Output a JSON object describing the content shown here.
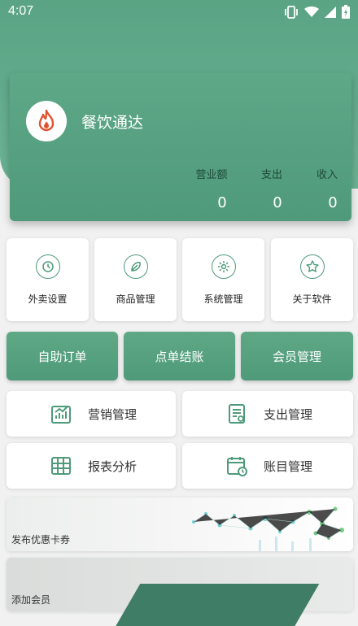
{
  "status": {
    "time": "4:07"
  },
  "app": {
    "name": "餐饮通达"
  },
  "stats": [
    {
      "label": "营业额",
      "value": "0"
    },
    {
      "label": "支出",
      "value": "0"
    },
    {
      "label": "收入",
      "value": "0"
    }
  ],
  "quick": [
    {
      "label": "外卖设置",
      "icon": "clock-icon"
    },
    {
      "label": "商品管理",
      "icon": "leaf-icon"
    },
    {
      "label": "系统管理",
      "icon": "gear-icon"
    },
    {
      "label": "关于软件",
      "icon": "star-icon"
    }
  ],
  "buttons": [
    {
      "label": "自助订单"
    },
    {
      "label": "点单结账"
    },
    {
      "label": "会员管理"
    }
  ],
  "menu": [
    {
      "label": "营销管理",
      "icon": "chart-icon"
    },
    {
      "label": "支出管理",
      "icon": "document-icon"
    },
    {
      "label": "报表分析",
      "icon": "table-icon"
    },
    {
      "label": "账目管理",
      "icon": "calendar-icon"
    }
  ],
  "banners": [
    {
      "label": "发布优惠卡券"
    },
    {
      "label": "添加会员"
    }
  ],
  "colors": {
    "primary": "#5aa384",
    "dark": "#1f4a3a",
    "icon": "#4e9a7a"
  }
}
